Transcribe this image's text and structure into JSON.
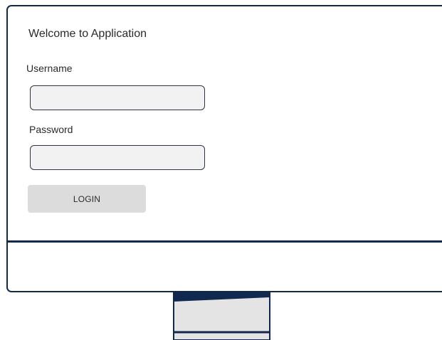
{
  "login_form": {
    "title": "Welcome to Application",
    "username_label": "Username",
    "username_value": "",
    "password_label": "Password",
    "password_value": "",
    "login_label": "LOGIN"
  },
  "colors": {
    "frame": "#12294f",
    "input_background": "#f2f2f2",
    "button_background": "#dcdcdc",
    "stand_fill": "#e4e4e4"
  }
}
